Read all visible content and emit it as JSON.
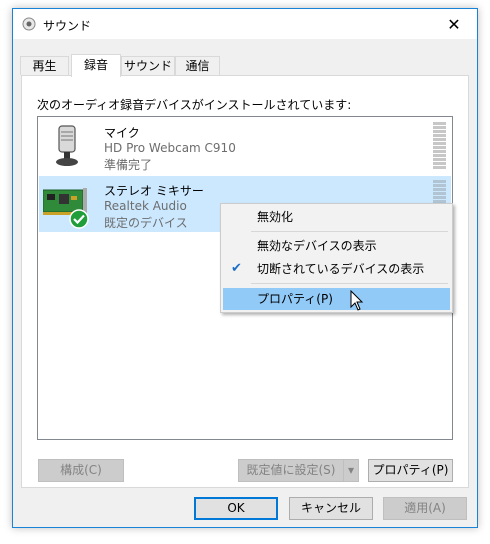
{
  "window": {
    "title": "サウンド",
    "close_glyph": "✕"
  },
  "tabs": [
    {
      "label": "再生"
    },
    {
      "label": "録音"
    },
    {
      "label": "サウンド"
    },
    {
      "label": "通信"
    }
  ],
  "instruction": "次のオーディオ録音デバイスがインストールされています:",
  "devices": [
    {
      "name": "マイク",
      "driver": "HD Pro Webcam C910",
      "status": "準備完了",
      "icon": "microphone-icon"
    },
    {
      "name": "ステレオ ミキサー",
      "driver": "Realtek Audio",
      "status": "既定のデバイス",
      "icon": "sound-card-icon"
    }
  ],
  "context_menu": {
    "items": [
      {
        "label": "無効化"
      },
      {
        "label": "無効なデバイスの表示"
      },
      {
        "label": "切断されているデバイスの表示",
        "checked": true
      },
      {
        "label": "プロパティ(P)",
        "highlighted": true
      }
    ],
    "check_glyph": "✔"
  },
  "panel_buttons": {
    "configure": "構成(C)",
    "set_default": "既定値に設定(S)",
    "dropdown_glyph": "▾",
    "properties": "プロパティ(P)"
  },
  "dialog_buttons": {
    "ok": "OK",
    "cancel": "キャンセル",
    "apply": "適用(A)"
  },
  "colors": {
    "accent": "#0078d7",
    "selection": "#cce8ff",
    "menu_highlight": "#91c9f7",
    "default_badge": "#1f9e3a"
  }
}
